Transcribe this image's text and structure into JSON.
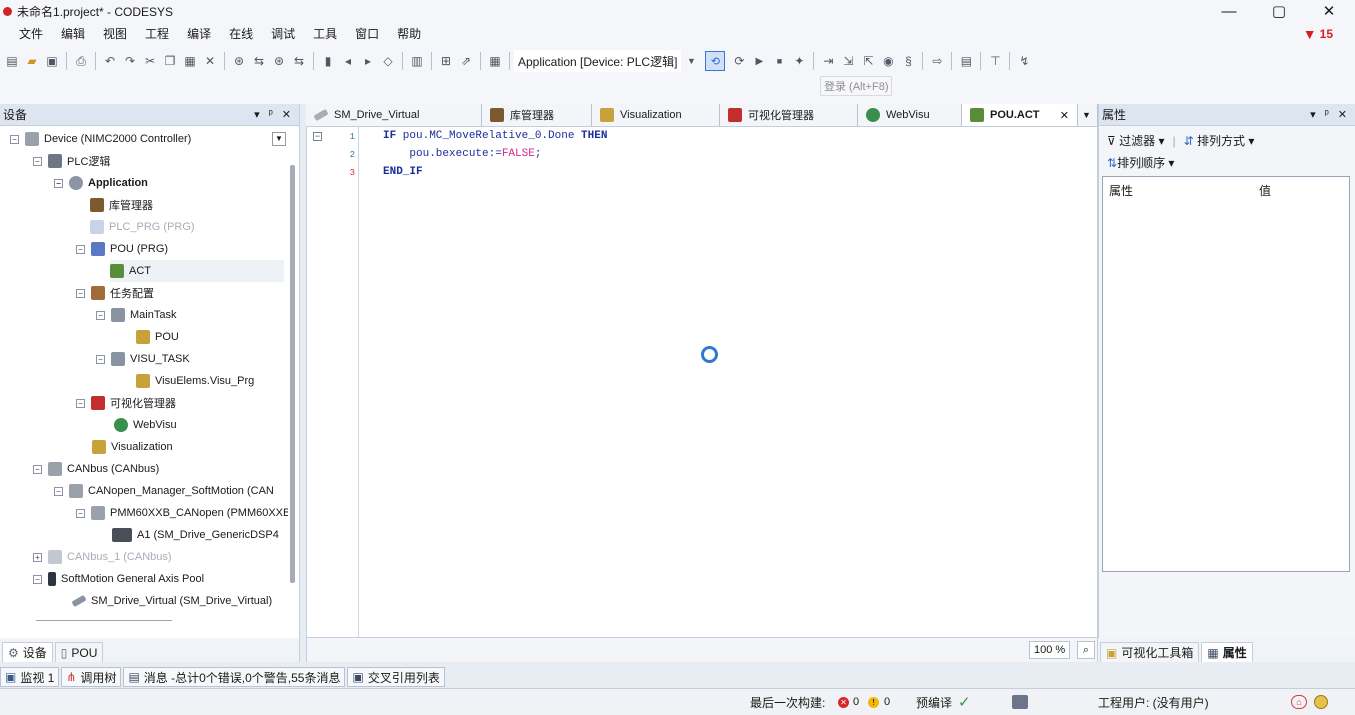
{
  "window": {
    "title": "未命名1.project* - CODESYS",
    "minimize": "—",
    "maximize": "▢",
    "close": "✕"
  },
  "menu": [
    "文件",
    "编辑",
    "视图",
    "工程",
    "编译",
    "在线",
    "调试",
    "工具",
    "窗口",
    "帮助"
  ],
  "error_count": "15",
  "toolbar": {
    "app_combo": "Application [Device: PLC逻辑]",
    "login_tooltip": "登录 (Alt+F8)"
  },
  "devices_pane": {
    "title": "设备",
    "pin": "▾ ᵖ ✕"
  },
  "tree": [
    {
      "label": "Device (NIMC2000 Controller)"
    },
    {
      "label": "PLC逻辑"
    },
    {
      "label": "Application"
    },
    {
      "label": "库管理器"
    },
    {
      "label": "PLC_PRG (PRG)"
    },
    {
      "label": "POU (PRG)"
    },
    {
      "label": "ACT"
    },
    {
      "label": "任务配置"
    },
    {
      "label": "MainTask"
    },
    {
      "label": "POU"
    },
    {
      "label": "VISU_TASK"
    },
    {
      "label": "VisuElems.Visu_Prg"
    },
    {
      "label": "可视化管理器"
    },
    {
      "label": "WebVisu"
    },
    {
      "label": "Visualization"
    },
    {
      "label": "CANbus (CANbus)"
    },
    {
      "label": "CANopen_Manager_SoftMotion (CAN"
    },
    {
      "label": "PMM60XXB_CANopen (PMM60XXB"
    },
    {
      "label": "A1 (SM_Drive_GenericDSP4"
    },
    {
      "label": "CANbus_1 (CANbus)"
    },
    {
      "label": "SoftMotion General Axis Pool"
    },
    {
      "label": "SM_Drive_Virtual (SM_Drive_Virtual)"
    }
  ],
  "left_tabs": [
    "设备",
    "POU"
  ],
  "editor_tabs": [
    "SM_Drive_Virtual",
    "库管理器",
    "Visualization",
    "可视化管理器",
    "WebVisu",
    "POU.ACT"
  ],
  "code": {
    "line_numbers": [
      "1",
      "2",
      "3"
    ],
    "line1": {
      "kw1": "IF",
      "body": " pou.MC_MoveRelative_0.Done ",
      "kw2": "THEN"
    },
    "line2": {
      "body": "    pou.bexecute:=",
      "lit": "FALSE",
      "end": ";"
    },
    "line3": {
      "kw": "END_IF"
    }
  },
  "zoom": "100 %",
  "props_pane": {
    "title": "属性",
    "filter": "过滤器 ▾",
    "sort": "排列方式 ▾",
    "order": "排列顺序 ▾",
    "col_prop": "属性",
    "col_value": "值"
  },
  "right_tabs": [
    "可视化工具箱",
    "属性"
  ],
  "message_tabs": [
    "监视 1",
    "调用树",
    "消息 -总计0个错误,0个警告,55条消息",
    "交叉引用列表"
  ],
  "status": {
    "last_build": "最后一次构建:",
    "errors": "0",
    "warnings": "0",
    "precompile": "预编译",
    "project_user": "工程用户: (没有用户)"
  }
}
